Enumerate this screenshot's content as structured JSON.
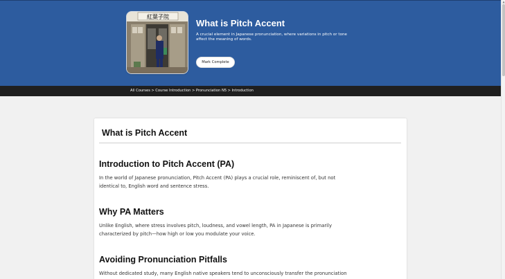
{
  "hero": {
    "title": "What is Pitch Accent",
    "description": "A crucial element in Japanese pronunciation, where variations in pitch or tone affect the meaning of words.",
    "mark_complete_label": "Mark Complete",
    "image_sign_text": "紅葉子院"
  },
  "breadcrumb": {
    "items": [
      "All Courses",
      "Course Introduction",
      "Pronunciation N5",
      "Introduction"
    ],
    "separator": ">"
  },
  "article": {
    "title": "What is Pitch Accent",
    "sections": [
      {
        "heading": "Introduction to Pitch Accent (PA)",
        "text": "In the world of Japanese pronunciation, Pitch Accent (PA) plays a crucial role, reminiscent of, but not identical to, English word and sentence stress."
      },
      {
        "heading": "Why PA Matters",
        "text": "Unlike English, where stress involves pitch, loudness, and vowel length, PA in Japanese is primarily characterized by pitch—how high or low you modulate your voice."
      },
      {
        "heading": "Avoiding Pronunciation Pitfalls",
        "text": "Without dedicated study, many English native speakers tend to unconsciously transfer the pronunciation"
      }
    ]
  },
  "colors": {
    "hero_bg": "#2d5c9f",
    "breadcrumb_bg": "#1f1f1f",
    "page_bg": "#f1f1f1"
  }
}
